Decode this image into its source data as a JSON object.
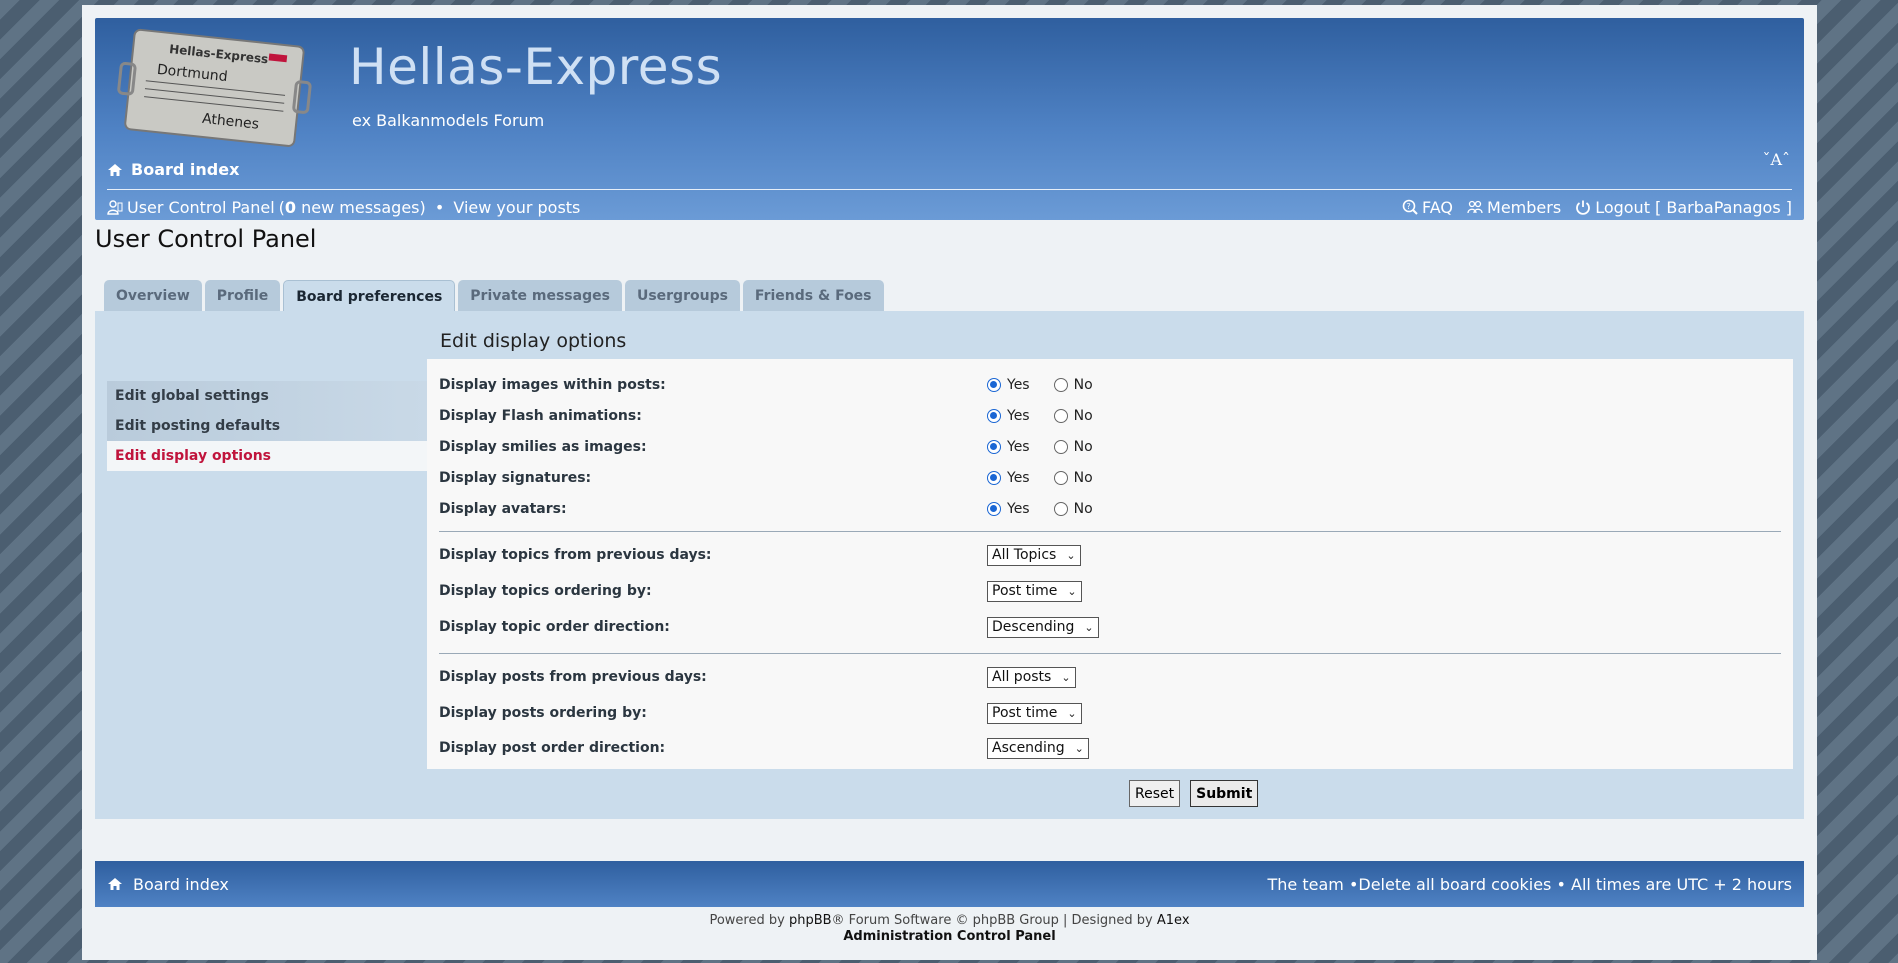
{
  "site": {
    "title": "Hellas-Express",
    "description": "ex Balkanmodels Forum",
    "logo_lines": [
      "Hellas-Express",
      "Dortmund",
      "Athenes"
    ],
    "font_toggle": "ˇAˆ"
  },
  "header": {
    "board_index": "Board index",
    "user_control_panel": "User Control Panel",
    "new_messages_count": "0",
    "new_messages_suffix": " new messages",
    "view_posts": "View your posts",
    "faq": "FAQ",
    "members": "Members",
    "logout": "Logout [ BarbaPanagos ]"
  },
  "page_title": "User Control Panel",
  "tabs": [
    {
      "label": "Overview"
    },
    {
      "label": "Profile"
    },
    {
      "label": "Board preferences",
      "active": true
    },
    {
      "label": "Private messages"
    },
    {
      "label": "Usergroups"
    },
    {
      "label": "Friends & Foes"
    }
  ],
  "side_menu": [
    {
      "label": "Edit global settings"
    },
    {
      "label": "Edit posting defaults"
    },
    {
      "label": "Edit display options",
      "active": true
    }
  ],
  "content_title": "Edit display options",
  "radio_rows": [
    {
      "label": "Display images within posts:",
      "value": "Yes"
    },
    {
      "label": "Display Flash animations:",
      "value": "Yes"
    },
    {
      "label": "Display smilies as images:",
      "value": "Yes"
    },
    {
      "label": "Display signatures:",
      "value": "Yes"
    },
    {
      "label": "Display avatars:",
      "value": "Yes"
    }
  ],
  "radio_labels": {
    "yes": "Yes",
    "no": "No"
  },
  "topic_rows": [
    {
      "label": "Display topics from previous days:",
      "value": "All Topics"
    },
    {
      "label": "Display topics ordering by:",
      "value": "Post time"
    },
    {
      "label": "Display topic order direction:",
      "value": "Descending"
    }
  ],
  "post_rows": [
    {
      "label": "Display posts from previous days:",
      "value": "All posts"
    },
    {
      "label": "Display posts ordering by:",
      "value": "Post time"
    },
    {
      "label": "Display post order direction:",
      "value": "Ascending"
    }
  ],
  "buttons": {
    "reset": "Reset",
    "submit": "Submit"
  },
  "footer": {
    "board_index": "Board index",
    "right_text": "The team •Delete all board cookies • All times are UTC + 2 hours",
    "powered_prefix": "Powered by ",
    "powered_phpbb": "phpBB",
    "powered_mid": "® Forum Software © phpBB Group | Designed by ",
    "powered_designer": "A1ex",
    "acp": "Administration Control Panel"
  },
  "colors": {
    "header_blue": "#2f5f9f",
    "active_menu": "#c0143c",
    "panel_bg": "#cadceb"
  }
}
